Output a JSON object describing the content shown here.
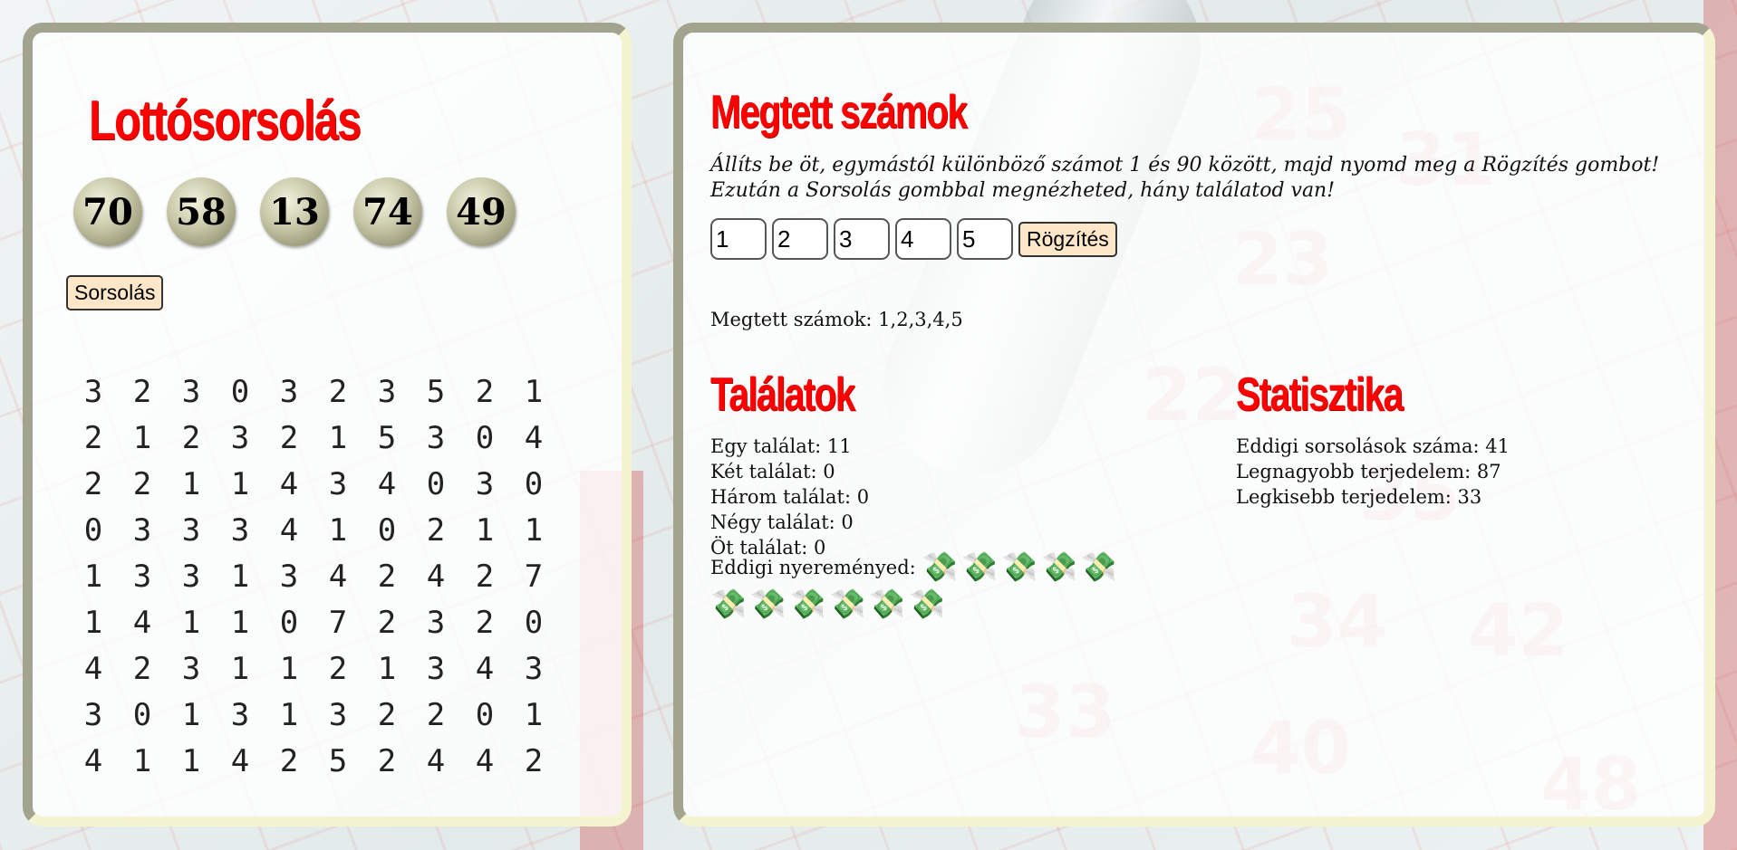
{
  "left": {
    "title": "Lottósorsolás",
    "drawn_numbers": [
      "70",
      "58",
      "13",
      "74",
      "49"
    ],
    "draw_button": "Sorsolás",
    "grid": [
      [
        "3",
        "2",
        "3",
        "0",
        "3",
        "2",
        "3",
        "5",
        "2",
        "1"
      ],
      [
        "2",
        "1",
        "2",
        "3",
        "2",
        "1",
        "5",
        "3",
        "0",
        "4"
      ],
      [
        "2",
        "2",
        "1",
        "1",
        "4",
        "3",
        "4",
        "0",
        "3",
        "0"
      ],
      [
        "0",
        "3",
        "3",
        "3",
        "4",
        "1",
        "0",
        "2",
        "1",
        "1"
      ],
      [
        "1",
        "3",
        "3",
        "1",
        "3",
        "4",
        "2",
        "4",
        "2",
        "7"
      ],
      [
        "1",
        "4",
        "1",
        "1",
        "0",
        "7",
        "2",
        "3",
        "2",
        "0"
      ],
      [
        "4",
        "2",
        "3",
        "1",
        "1",
        "2",
        "1",
        "3",
        "4",
        "3"
      ],
      [
        "3",
        "0",
        "1",
        "3",
        "1",
        "3",
        "2",
        "2",
        "0",
        "1"
      ],
      [
        "4",
        "1",
        "1",
        "4",
        "2",
        "5",
        "2",
        "4",
        "4",
        "2"
      ]
    ]
  },
  "right": {
    "title": "Megtett számok",
    "instruction_1": "Állíts be öt, egymástól különböző számot 1 és 90 között, majd nyomd meg a Rögzítés gombot!",
    "instruction_2": "Ezután a Sorsolás gombbal megnézheted, hány találatod van!",
    "inputs": [
      "1",
      "2",
      "3",
      "4",
      "5"
    ],
    "save_button": "Rögzítés",
    "picked_label": "Megtett számok: 1,2,3,4,5"
  },
  "hits": {
    "title": "Találatok",
    "one": "Egy találat: 11",
    "two": "Két találat: 0",
    "three": "Három találat: 0",
    "four": "Négy találat: 0",
    "five": "Öt találat: 0",
    "winnings_label": "Eddigi nyereményed:",
    "money_icons": "💸💸💸💸💸💸💸💸💸💸💸"
  },
  "stats": {
    "title": "Statisztika",
    "draws": "Eddigi sorsolások száma: 41",
    "max_range": "Legnagyobb terjedelem: 87",
    "min_range": "Legkisebb terjedelem: 33"
  },
  "colors": {
    "heading": "#ff0000",
    "button_bg": "#fde7c8",
    "ball": "#c7c7a7",
    "panel_border": "#a3a48f"
  }
}
